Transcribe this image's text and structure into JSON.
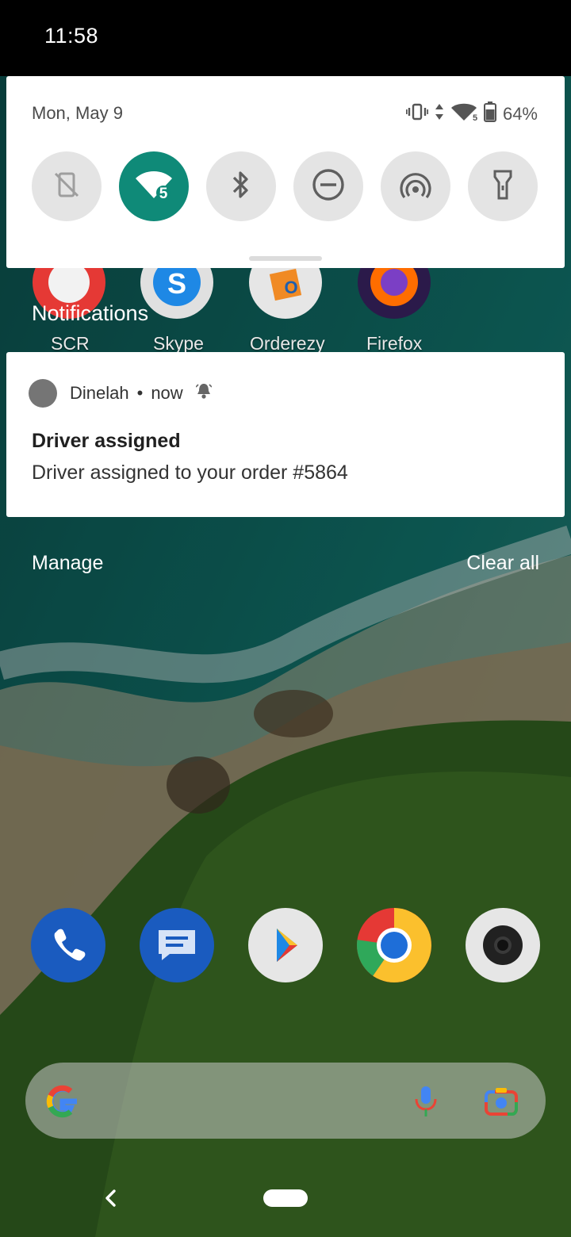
{
  "status_bar": {
    "time": "11:58"
  },
  "quick_settings": {
    "date": "Mon, May 9",
    "battery": "64%",
    "tiles": [
      {
        "name": "auto-rotate",
        "active": false
      },
      {
        "name": "wifi",
        "active": true,
        "badge": "5"
      },
      {
        "name": "bluetooth",
        "active": false
      },
      {
        "name": "do-not-disturb",
        "active": false
      },
      {
        "name": "hotspot",
        "active": false
      },
      {
        "name": "flashlight",
        "active": false
      }
    ]
  },
  "home_apps": [
    {
      "label": "SCR"
    },
    {
      "label": "Skype"
    },
    {
      "label": "Orderezy"
    },
    {
      "label": "Firefox"
    }
  ],
  "notifications": {
    "header": "Notifications",
    "items": [
      {
        "app": "Dinelah",
        "time": "now",
        "title": "Driver assigned",
        "body": "Driver assigned to your order #5864"
      }
    ],
    "manage_label": "Manage",
    "clear_all_label": "Clear all"
  },
  "dock": [
    "phone",
    "messages",
    "play-store",
    "chrome",
    "camera"
  ],
  "colors": {
    "accent": "#0f8a78",
    "panel": "#ffffff"
  }
}
